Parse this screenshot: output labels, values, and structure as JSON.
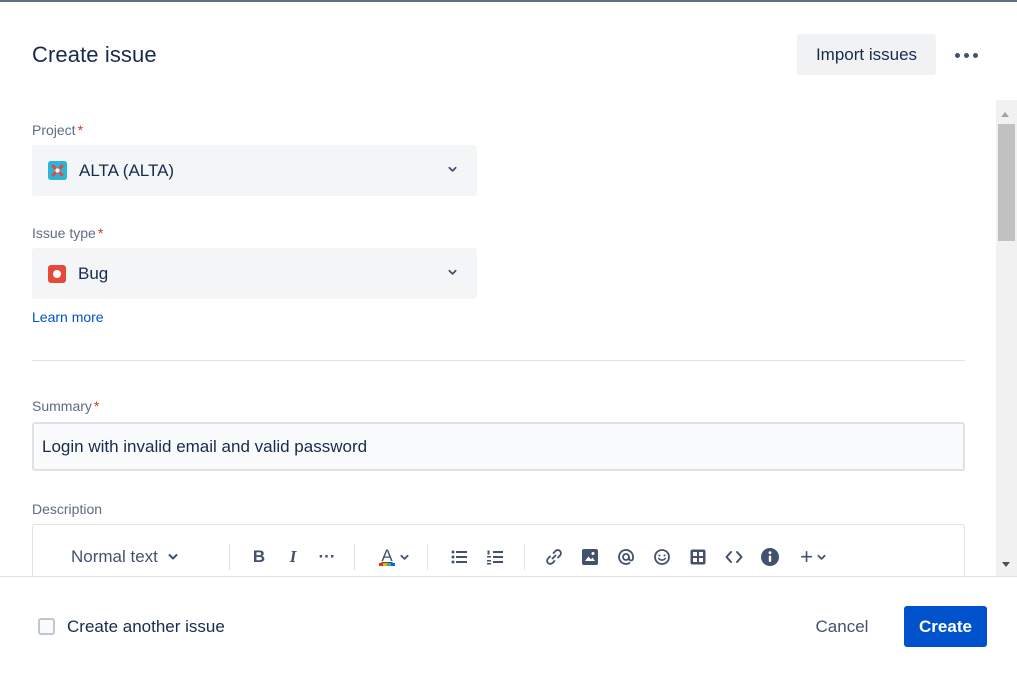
{
  "header": {
    "title": "Create issue",
    "import_label": "Import issues",
    "more_icon": "more-horizontal-icon"
  },
  "fields": {
    "required_marker": "*",
    "project": {
      "label": "Project",
      "value": "ALTA (ALTA)",
      "icon": "project-avatar-icon"
    },
    "issue_type": {
      "label": "Issue type",
      "value": "Bug",
      "icon": "bug-icon"
    },
    "learn_more": "Learn more",
    "summary": {
      "label": "Summary",
      "value": "Login with invalid email and valid password"
    },
    "description": {
      "label": "Description"
    }
  },
  "editor_toolbar": {
    "text_style": "Normal text",
    "bold": "B",
    "italic": "I",
    "more": "···",
    "text_color": "A",
    "plus": "+"
  },
  "footer": {
    "create_another_label": "Create another issue",
    "create_another_checked": false,
    "cancel_label": "Cancel",
    "create_label": "Create"
  },
  "colors": {
    "primary": "#0052cc",
    "required": "#de350b",
    "bug": "#e5493a",
    "project": "#2cb5d9"
  }
}
